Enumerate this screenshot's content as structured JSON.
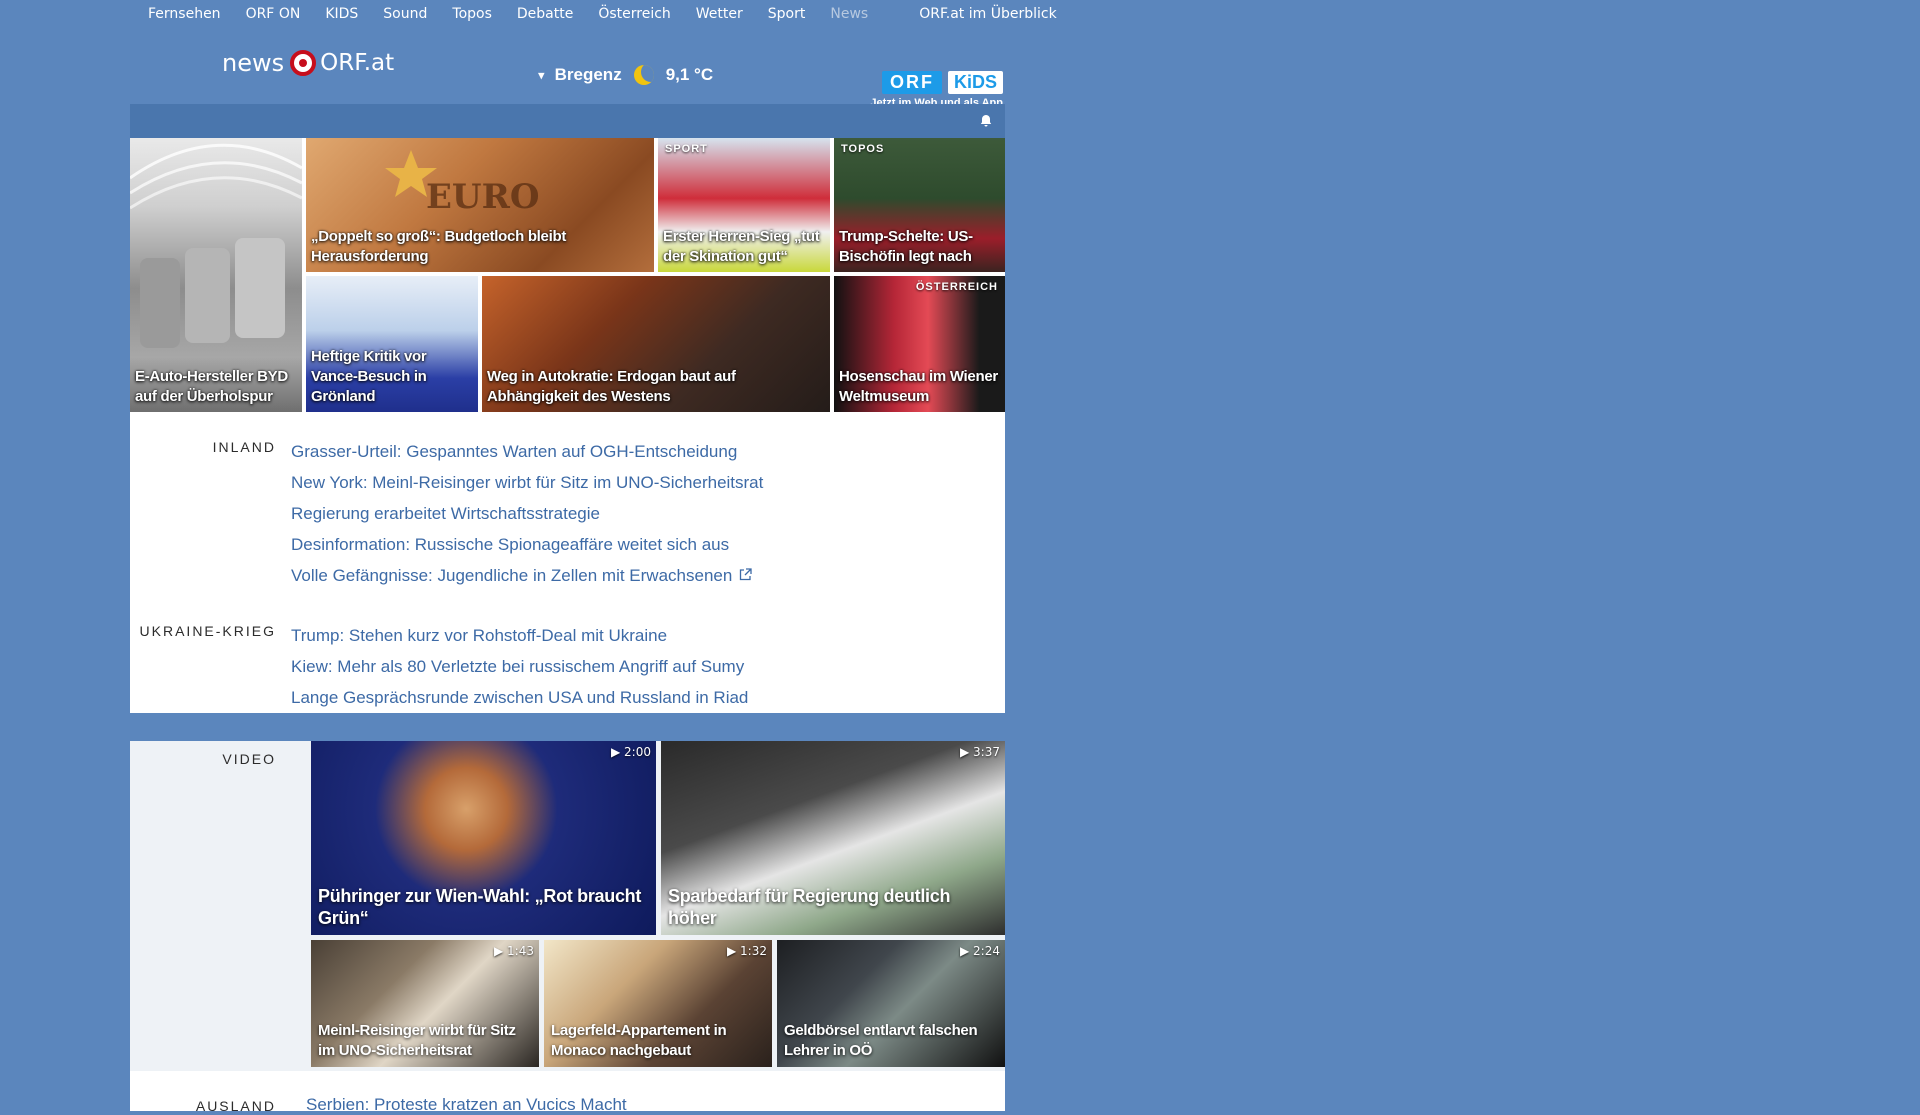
{
  "topnav": {
    "items": [
      "Fernsehen",
      "ORF ON",
      "KIDS",
      "Sound",
      "Topos",
      "Debatte",
      "Österreich",
      "Wetter",
      "Sport",
      "News"
    ],
    "active": "News",
    "overview": "ORF.at im Überblick"
  },
  "header": {
    "brand_news": "news",
    "brand_site": "ORF.at",
    "weather_city": "Bregenz",
    "weather_temp": "9,1 °C",
    "kids_orf": "ORF",
    "kids_kids": "KiDS",
    "kids_tagline": "Jetzt im Web und als App"
  },
  "tiles": [
    {
      "caption": "E-Auto-Hersteller BYD auf der Überholspur",
      "category": ""
    },
    {
      "caption": "„Doppelt so groß“: Budgetloch bleibt Herausforderung",
      "category": ""
    },
    {
      "caption": "Erster Herren-Sieg „tut der Skination gut“",
      "category": "SPORT"
    },
    {
      "caption": "Trump-Schelte: US-Bischöfin legt nach",
      "category": "TOPOS"
    },
    {
      "caption": "Heftige Kritik vor Vance-Besuch in Grönland",
      "category": ""
    },
    {
      "caption": "Weg in Autokratie: Erdogan baut auf Abhängigkeit des Westens",
      "category": ""
    },
    {
      "caption": "Hosenschau im Wiener Weltmuseum",
      "category": "ÖSTERREICH"
    }
  ],
  "sections": [
    {
      "label": "INLAND",
      "links": [
        "Grasser-Urteil: Gespanntes Warten auf OGH-Entscheidung",
        "New York: Meinl-Reisinger wirbt für Sitz im UNO-Sicherheitsrat",
        "Regierung erarbeitet Wirtschaftsstrategie",
        "Desinformation: Russische Spionageaffäre weitet sich aus",
        "Volle Gefängnisse: Jugendliche in Zellen mit Erwachsenen"
      ]
    },
    {
      "label": "UKRAINE-KRIEG",
      "links": [
        "Trump: Stehen kurz vor Rohstoff-Deal mit Ukraine",
        "Kiew: Mehr als 80 Verletzte bei russischem Angriff auf Sumy",
        "Lange Gesprächsrunde zwischen USA und Russland in Riad"
      ]
    }
  ],
  "video": {
    "label": "VIDEO",
    "items": [
      {
        "caption": "Pühringer zur Wien-Wahl: „Rot braucht Grün“",
        "duration": "2:00"
      },
      {
        "caption": "Sparbedarf für Regierung deutlich höher",
        "duration": "3:37"
      },
      {
        "caption": "Meinl-Reisinger wirbt für Sitz im UNO-Sicherheitsrat",
        "duration": "1:43"
      },
      {
        "caption": "Lagerfeld-Appartement in Monaco nachgebaut",
        "duration": "1:32"
      },
      {
        "caption": "Geldbörsel entlarvt falschen Lehrer in OÖ",
        "duration": "2:24"
      }
    ]
  },
  "next_section": {
    "label": "AUSLAND",
    "link": "Serbien: Proteste kratzen an Vucics Macht"
  }
}
